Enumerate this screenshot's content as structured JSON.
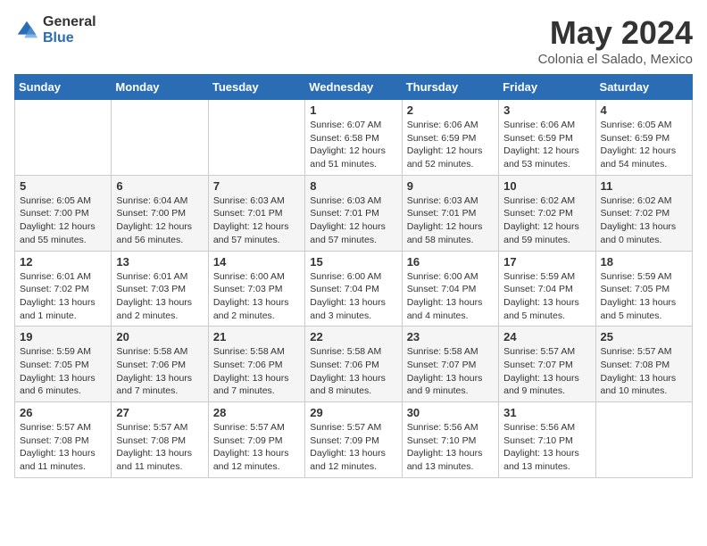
{
  "header": {
    "logo_line1": "General",
    "logo_line2": "Blue",
    "month_year": "May 2024",
    "location": "Colonia el Salado, Mexico"
  },
  "days_of_week": [
    "Sunday",
    "Monday",
    "Tuesday",
    "Wednesday",
    "Thursday",
    "Friday",
    "Saturday"
  ],
  "weeks": [
    [
      {
        "day": "",
        "info": ""
      },
      {
        "day": "",
        "info": ""
      },
      {
        "day": "",
        "info": ""
      },
      {
        "day": "1",
        "info": "Sunrise: 6:07 AM\nSunset: 6:58 PM\nDaylight: 12 hours\nand 51 minutes."
      },
      {
        "day": "2",
        "info": "Sunrise: 6:06 AM\nSunset: 6:59 PM\nDaylight: 12 hours\nand 52 minutes."
      },
      {
        "day": "3",
        "info": "Sunrise: 6:06 AM\nSunset: 6:59 PM\nDaylight: 12 hours\nand 53 minutes."
      },
      {
        "day": "4",
        "info": "Sunrise: 6:05 AM\nSunset: 6:59 PM\nDaylight: 12 hours\nand 54 minutes."
      }
    ],
    [
      {
        "day": "5",
        "info": "Sunrise: 6:05 AM\nSunset: 7:00 PM\nDaylight: 12 hours\nand 55 minutes."
      },
      {
        "day": "6",
        "info": "Sunrise: 6:04 AM\nSunset: 7:00 PM\nDaylight: 12 hours\nand 56 minutes."
      },
      {
        "day": "7",
        "info": "Sunrise: 6:03 AM\nSunset: 7:01 PM\nDaylight: 12 hours\nand 57 minutes."
      },
      {
        "day": "8",
        "info": "Sunrise: 6:03 AM\nSunset: 7:01 PM\nDaylight: 12 hours\nand 57 minutes."
      },
      {
        "day": "9",
        "info": "Sunrise: 6:03 AM\nSunset: 7:01 PM\nDaylight: 12 hours\nand 58 minutes."
      },
      {
        "day": "10",
        "info": "Sunrise: 6:02 AM\nSunset: 7:02 PM\nDaylight: 12 hours\nand 59 minutes."
      },
      {
        "day": "11",
        "info": "Sunrise: 6:02 AM\nSunset: 7:02 PM\nDaylight: 13 hours\nand 0 minutes."
      }
    ],
    [
      {
        "day": "12",
        "info": "Sunrise: 6:01 AM\nSunset: 7:02 PM\nDaylight: 13 hours\nand 1 minute."
      },
      {
        "day": "13",
        "info": "Sunrise: 6:01 AM\nSunset: 7:03 PM\nDaylight: 13 hours\nand 2 minutes."
      },
      {
        "day": "14",
        "info": "Sunrise: 6:00 AM\nSunset: 7:03 PM\nDaylight: 13 hours\nand 2 minutes."
      },
      {
        "day": "15",
        "info": "Sunrise: 6:00 AM\nSunset: 7:04 PM\nDaylight: 13 hours\nand 3 minutes."
      },
      {
        "day": "16",
        "info": "Sunrise: 6:00 AM\nSunset: 7:04 PM\nDaylight: 13 hours\nand 4 minutes."
      },
      {
        "day": "17",
        "info": "Sunrise: 5:59 AM\nSunset: 7:04 PM\nDaylight: 13 hours\nand 5 minutes."
      },
      {
        "day": "18",
        "info": "Sunrise: 5:59 AM\nSunset: 7:05 PM\nDaylight: 13 hours\nand 5 minutes."
      }
    ],
    [
      {
        "day": "19",
        "info": "Sunrise: 5:59 AM\nSunset: 7:05 PM\nDaylight: 13 hours\nand 6 minutes."
      },
      {
        "day": "20",
        "info": "Sunrise: 5:58 AM\nSunset: 7:06 PM\nDaylight: 13 hours\nand 7 minutes."
      },
      {
        "day": "21",
        "info": "Sunrise: 5:58 AM\nSunset: 7:06 PM\nDaylight: 13 hours\nand 7 minutes."
      },
      {
        "day": "22",
        "info": "Sunrise: 5:58 AM\nSunset: 7:06 PM\nDaylight: 13 hours\nand 8 minutes."
      },
      {
        "day": "23",
        "info": "Sunrise: 5:58 AM\nSunset: 7:07 PM\nDaylight: 13 hours\nand 9 minutes."
      },
      {
        "day": "24",
        "info": "Sunrise: 5:57 AM\nSunset: 7:07 PM\nDaylight: 13 hours\nand 9 minutes."
      },
      {
        "day": "25",
        "info": "Sunrise: 5:57 AM\nSunset: 7:08 PM\nDaylight: 13 hours\nand 10 minutes."
      }
    ],
    [
      {
        "day": "26",
        "info": "Sunrise: 5:57 AM\nSunset: 7:08 PM\nDaylight: 13 hours\nand 11 minutes."
      },
      {
        "day": "27",
        "info": "Sunrise: 5:57 AM\nSunset: 7:08 PM\nDaylight: 13 hours\nand 11 minutes."
      },
      {
        "day": "28",
        "info": "Sunrise: 5:57 AM\nSunset: 7:09 PM\nDaylight: 13 hours\nand 12 minutes."
      },
      {
        "day": "29",
        "info": "Sunrise: 5:57 AM\nSunset: 7:09 PM\nDaylight: 13 hours\nand 12 minutes."
      },
      {
        "day": "30",
        "info": "Sunrise: 5:56 AM\nSunset: 7:10 PM\nDaylight: 13 hours\nand 13 minutes."
      },
      {
        "day": "31",
        "info": "Sunrise: 5:56 AM\nSunset: 7:10 PM\nDaylight: 13 hours\nand 13 minutes."
      },
      {
        "day": "",
        "info": ""
      }
    ]
  ]
}
